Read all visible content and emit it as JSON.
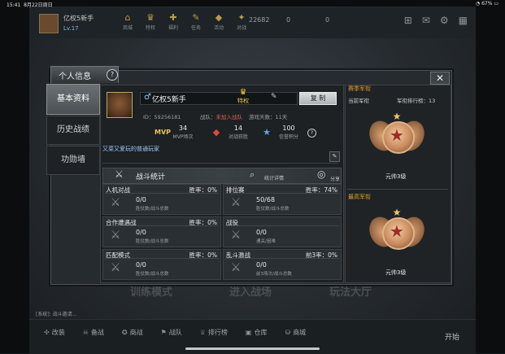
{
  "status": {
    "time": "15:41",
    "date": "8月22日周日",
    "battery": "67%"
  },
  "topbar": {
    "name": "亿权5新手",
    "level": "Lv.17",
    "icons": [
      {
        "label": "商城",
        "icon": "shop-icon"
      },
      {
        "label": "特权",
        "icon": "crown-icon"
      },
      {
        "label": "福利",
        "icon": "gift-icon"
      },
      {
        "label": "任务",
        "icon": "task-icon"
      },
      {
        "label": "活动",
        "icon": "event-icon"
      },
      {
        "label": "对战",
        "icon": "battle-icon"
      }
    ],
    "gold": "22682",
    "diamond": "0",
    "tickets": "0"
  },
  "bottombar": {
    "chat": "[系统]: 战斗邀请...",
    "items": [
      "改装",
      "备战",
      "商战",
      "战队",
      "排行榜",
      "仓库",
      "商城"
    ],
    "start": "开始",
    "bg_labels": [
      "训练模式",
      "进入战场",
      "玩法大厅"
    ]
  },
  "modal": {
    "tab_title": "个人信息",
    "help": "?",
    "close": "✕",
    "nav": [
      "基本资料",
      "历史战绩",
      "功勋墙"
    ],
    "profile": {
      "nickname": "亿权5新手",
      "vip_label": "特权",
      "copy_label": "复 制",
      "id_label": "ID：59256181",
      "team_label": "战队：",
      "team_value": "未加入战队",
      "days_label": "游戏天数：11天",
      "stats": [
        {
          "value": "34",
          "label": "MVP场次",
          "icon": "mvp-icon"
        },
        {
          "value": "14",
          "label": "对战获胜",
          "icon": "heart-icon"
        },
        {
          "value": "100",
          "label": "信誉积分",
          "icon": "star-badge-icon"
        }
      ],
      "signature": "又菜又爱玩的普通玩家"
    },
    "battle": {
      "title": "战斗统计",
      "detail": "统计详情",
      "share": "分享",
      "modes": [
        {
          "name": "人机对战",
          "rate_label": "胜率：",
          "rate": "0%",
          "nums": "0/0",
          "sub": "胜仗数/战斗总数"
        },
        {
          "name": "排位赛",
          "rate_label": "胜率：",
          "rate": "74%",
          "nums": "50/68",
          "sub": "胜仗数/战斗总数"
        },
        {
          "name": "合作遭遇战",
          "rate_label": "胜率：",
          "rate": "0%",
          "nums": "0/0",
          "sub": "胜仗数/战斗总数"
        },
        {
          "name": "战役",
          "rate_label": "",
          "rate": "",
          "nums": "0/0",
          "sub": "通关/困难"
        },
        {
          "name": "匹配模式",
          "rate_label": "胜率：",
          "rate": "0%",
          "nums": "0/0",
          "sub": "胜仗数/战斗总数"
        },
        {
          "name": "乱斗激战",
          "rate_label": "前3率：",
          "rate": "0%",
          "nums": "0/0",
          "sub": "前3场次/战斗总数"
        }
      ]
    },
    "rank": {
      "title": "赛季军衔",
      "current_label": "当前军衔",
      "position_label": "军衔排行榜：13",
      "current_rank": "元帅3级",
      "highest_label": "最高军衔",
      "highest_rank": "元帅3级"
    }
  },
  "colors": {
    "accent_gold": "#e4a030",
    "win_rate_blue": "#9fc8ff",
    "team_red": "#e85a4c"
  }
}
